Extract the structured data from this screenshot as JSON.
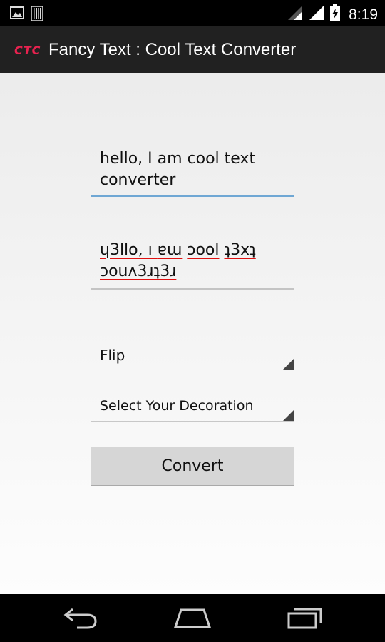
{
  "status_bar": {
    "time": "8:19"
  },
  "app": {
    "logo_text": "CTC",
    "title": "Fancy Text : Cool Text Converter",
    "accent_color": "#e8224f"
  },
  "input": {
    "value": "hello, I am cool text\nconverter"
  },
  "output": {
    "line1": [
      "ɥ3llo, ı ",
      "ɐɯ",
      " ",
      "ɔool",
      " ",
      "ʇ3xʇ"
    ],
    "line2": "ɔouʌ3ɹʇ3ɹ"
  },
  "style_spinner": {
    "selected": "Flip"
  },
  "decoration_spinner": {
    "selected": "Select Your Decoration"
  },
  "convert_button": {
    "label": "Convert"
  },
  "icons": {
    "status_left": [
      "image-icon",
      "barcode-icon"
    ],
    "status_right": [
      "wifi-icon",
      "signal-icon",
      "battery-charging-icon"
    ],
    "nav": [
      "back-icon",
      "home-icon",
      "recent-apps-icon"
    ]
  }
}
